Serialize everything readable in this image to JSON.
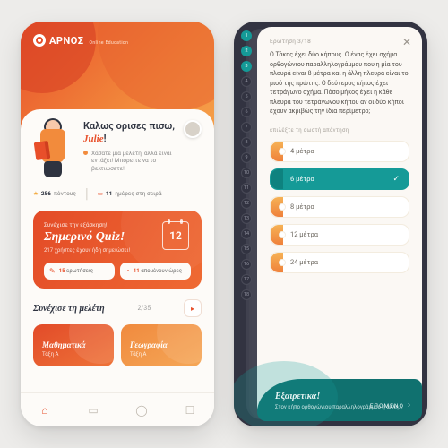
{
  "brand": {
    "name": "ΑΡΝΟΣ",
    "tag": "Online Education"
  },
  "welcome": {
    "line": "Καλως ορισες πισω,",
    "user": "Julie",
    "suffix": "!",
    "sub": "Χάσατε μια μελέτη, αλλά είναι εντάξει! Μπορείτε να το βελτιώσετε!"
  },
  "stats": {
    "points_n": "256",
    "points_l": "πόντους",
    "streak_n": "11",
    "streak_l": "ημέρες στη σειρά"
  },
  "quiz": {
    "kicker": "Συνέχισε την εξάσκηση!",
    "title": "Σημερινό Quiz!",
    "meta": "217 χρήστες έχουν ήδη σημειώσει!",
    "date": "12",
    "chip_q_n": "15",
    "chip_q_l": " ερωτήσεις",
    "chip_t_n": "11",
    "chip_t_l": " απομένουν ώρες"
  },
  "study": {
    "title": "Συνέχισε τη μελέτη",
    "progress": "2/35"
  },
  "subjects": [
    {
      "name": "Μαθηματικά",
      "grade": "Τάξη Α"
    },
    {
      "name": "Γεωγραφία",
      "grade": "Τάξη Α"
    }
  ],
  "q": {
    "counter": "Ερώτηση 3/18",
    "body": "Ο Τάκης έχει δύο κήπους. Ο ένας έχει σχήμα ορθογώνιου παραλληλογράμμου που η μία του πλευρά είναι 8 μέτρα και η άλλη πλευρά είναι το μισό της πρώτης. Ο δεύτερος κήπος έχει τετράγωνο σχήμα. Πόσο μήκος έχει η κάθε πλευρά του τετράγωνου κήπου αν οι δύο κήποι έχουν ακριβώς την ίδια περίμετρο;",
    "pick": "επιλέξτε τη σωστή απάντηση"
  },
  "opts": [
    {
      "t": "4 μέτρα"
    },
    {
      "t": "6 μέτρα",
      "sel": true
    },
    {
      "t": "8 μέτρα"
    },
    {
      "t": "12 μέτρα"
    },
    {
      "t": "24 μέτρα"
    }
  ],
  "fb": {
    "title": "Εξαιρετικά!",
    "body": "Στον κήπο ορθογώνιου παραλληλογράμμου η άλλη...",
    "next": "ΕΠΟΜΕΝΟ"
  }
}
